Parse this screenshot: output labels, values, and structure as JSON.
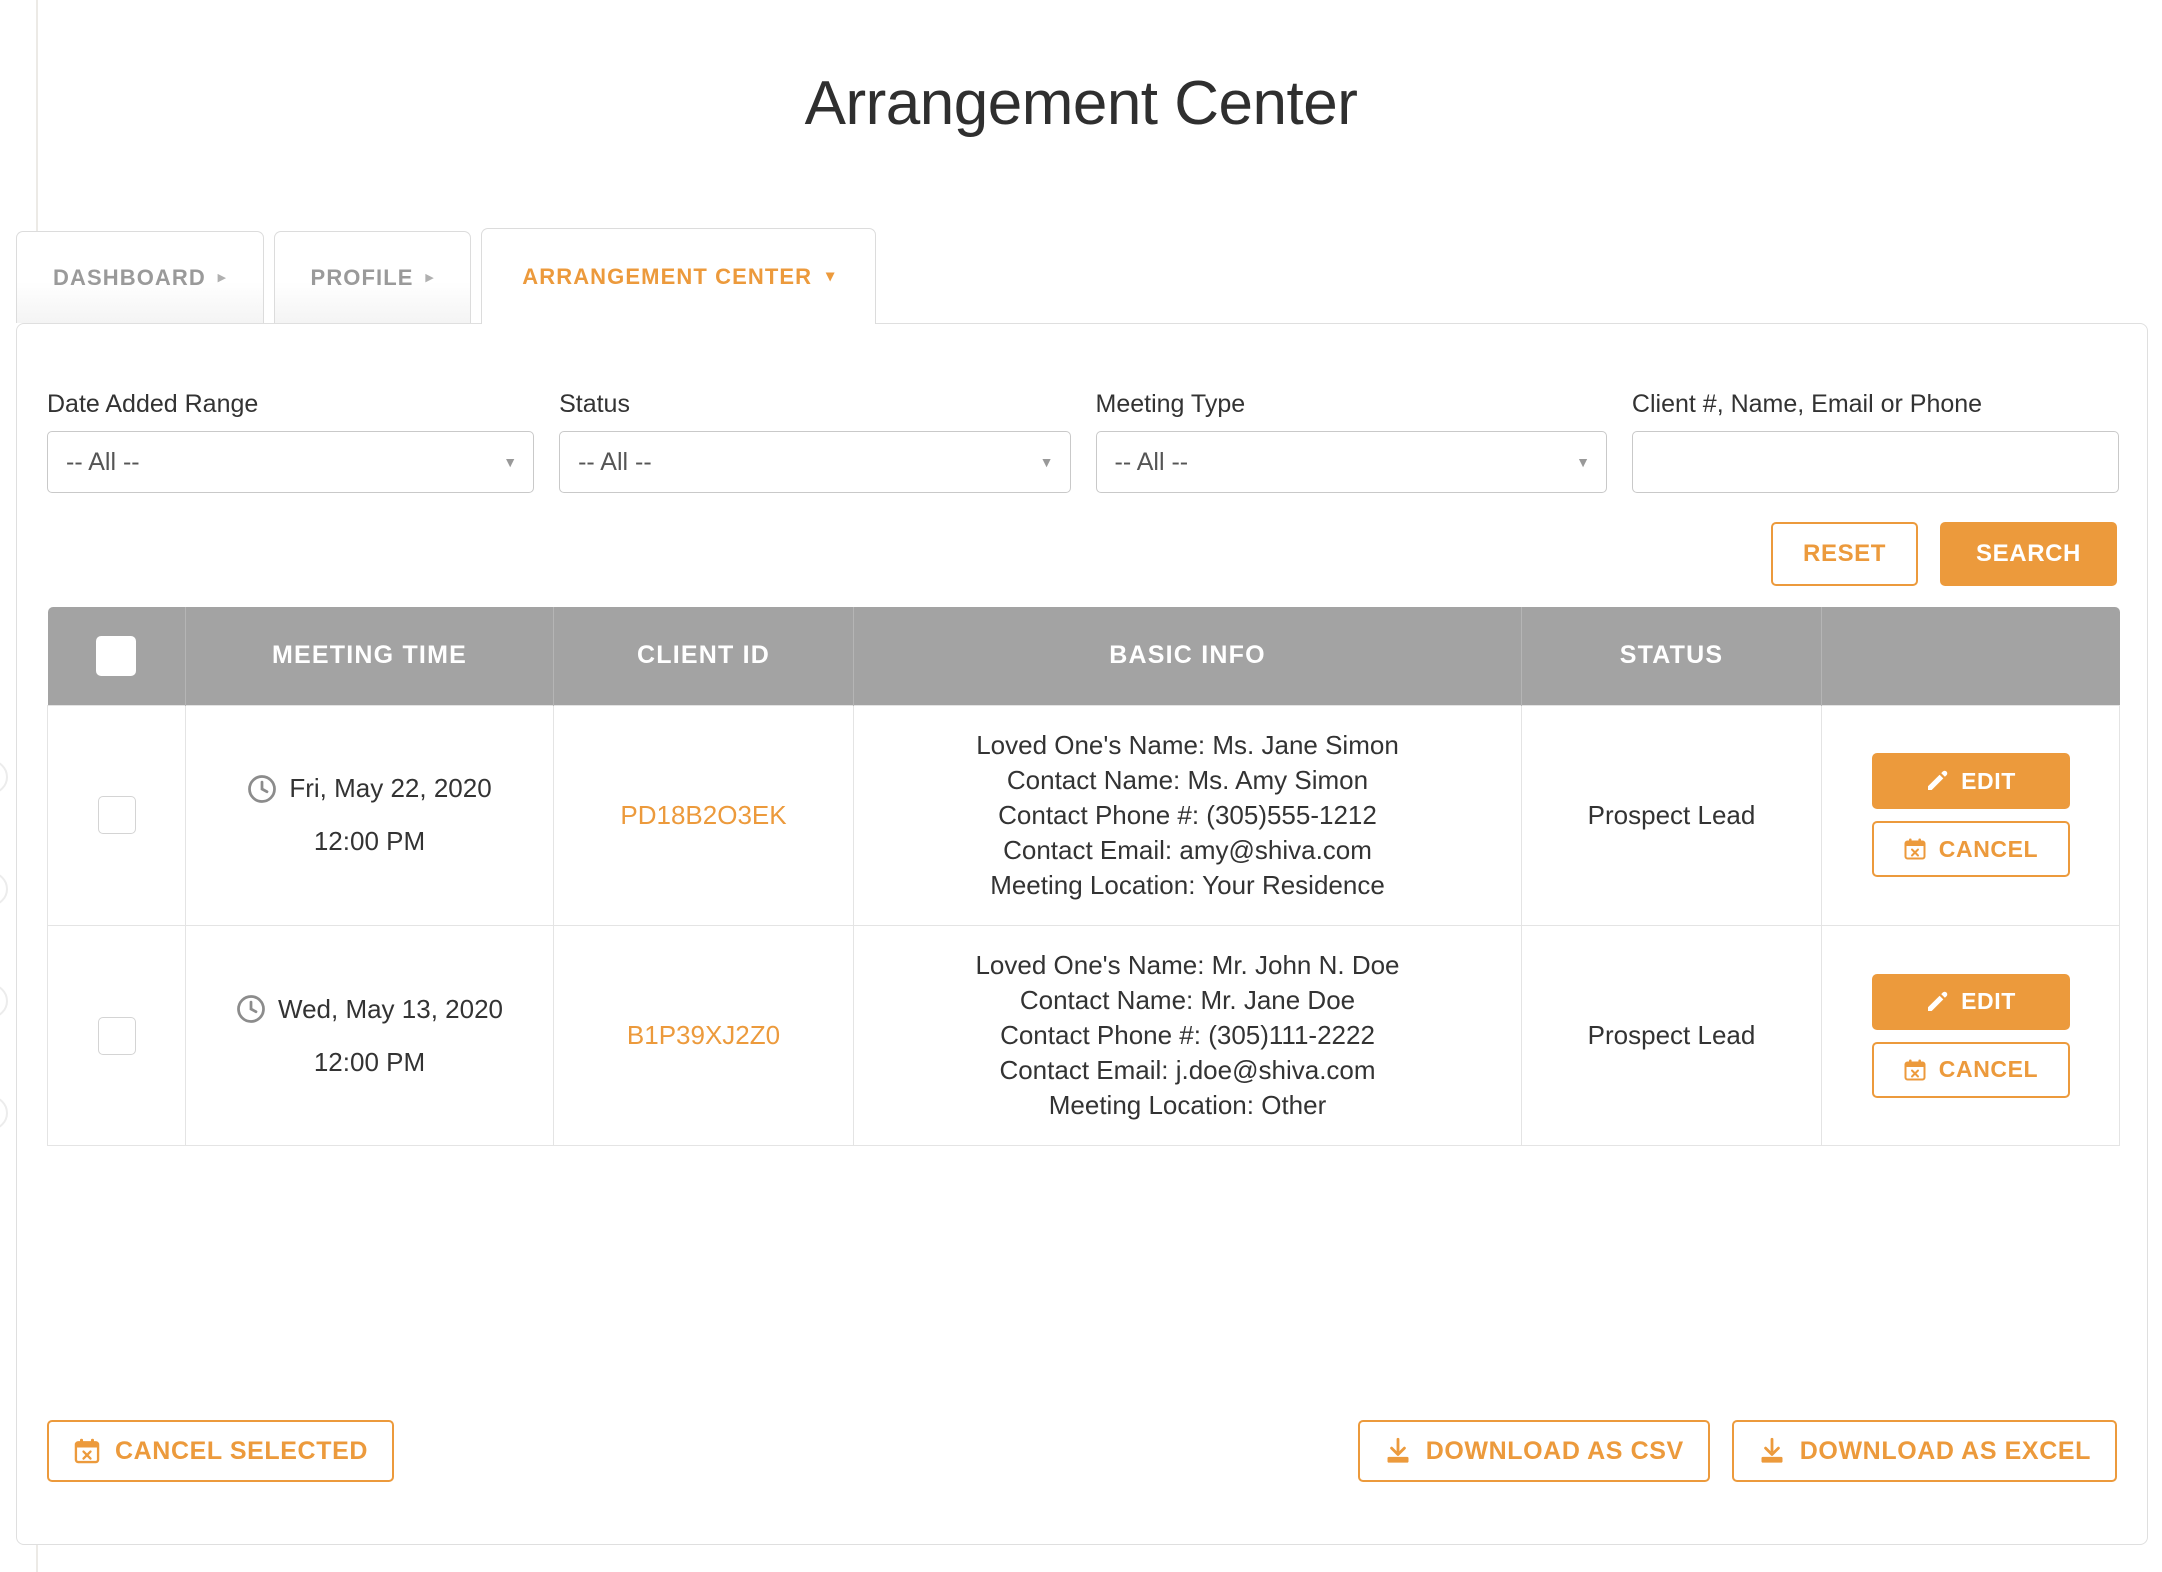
{
  "page": {
    "title": "Arrangement Center"
  },
  "tabs": [
    {
      "label": "DASHBOARD",
      "icon": "chevron-right-icon",
      "active": false
    },
    {
      "label": "PROFILE",
      "icon": "chevron-right-icon",
      "active": false
    },
    {
      "label": "ARRANGEMENT CENTER",
      "icon": "chevron-down-icon",
      "active": true
    }
  ],
  "filters": [
    {
      "label": "Date Added Range",
      "type": "select",
      "value": "-- All --"
    },
    {
      "label": "Status",
      "type": "select",
      "value": "-- All --"
    },
    {
      "label": "Meeting Type",
      "type": "select",
      "value": "-- All --"
    },
    {
      "label": "Client #, Name, Email or Phone",
      "type": "text",
      "value": "",
      "placeholder": ""
    }
  ],
  "search_actions": {
    "reset_label": "RESET",
    "search_label": "SEARCH"
  },
  "table": {
    "columns": [
      "",
      "MEETING TIME",
      "CLIENT ID",
      "BASIC INFO",
      "STATUS",
      ""
    ],
    "rows": [
      {
        "selected": false,
        "date": "Fri, May 22, 2020",
        "time": "12:00 PM",
        "client_id": "PD18B2O3EK",
        "info": [
          "Loved One's Name: Ms. Jane Simon",
          "Contact Name: Ms. Amy Simon",
          "Contact Phone #: (305)555-1212",
          "Contact Email: amy@shiva.com",
          "Meeting Location: Your Residence"
        ],
        "status": "Prospect Lead",
        "edit_label": "EDIT",
        "cancel_label": "CANCEL"
      },
      {
        "selected": false,
        "date": "Wed, May 13, 2020",
        "time": "12:00 PM",
        "client_id": "B1P39XJ2Z0",
        "info": [
          "Loved One's Name: Mr. John N. Doe",
          "Contact Name: Mr. Jane Doe",
          "Contact Phone #: (305)111-2222",
          "Contact Email: j.doe@shiva.com",
          "Meeting Location: Other"
        ],
        "status": "Prospect Lead",
        "edit_label": "EDIT",
        "cancel_label": "CANCEL"
      }
    ]
  },
  "footer": {
    "cancel_selected_label": "CANCEL SELECTED",
    "download_csv_label": "DOWNLOAD AS CSV",
    "download_excel_label": "DOWNLOAD AS EXCEL"
  },
  "colors": {
    "accent": "#ec9a3c",
    "header_gray": "#a3a3a3",
    "text": "#333333",
    "muted": "#9a9a9a",
    "border": "#dfdfdf"
  }
}
